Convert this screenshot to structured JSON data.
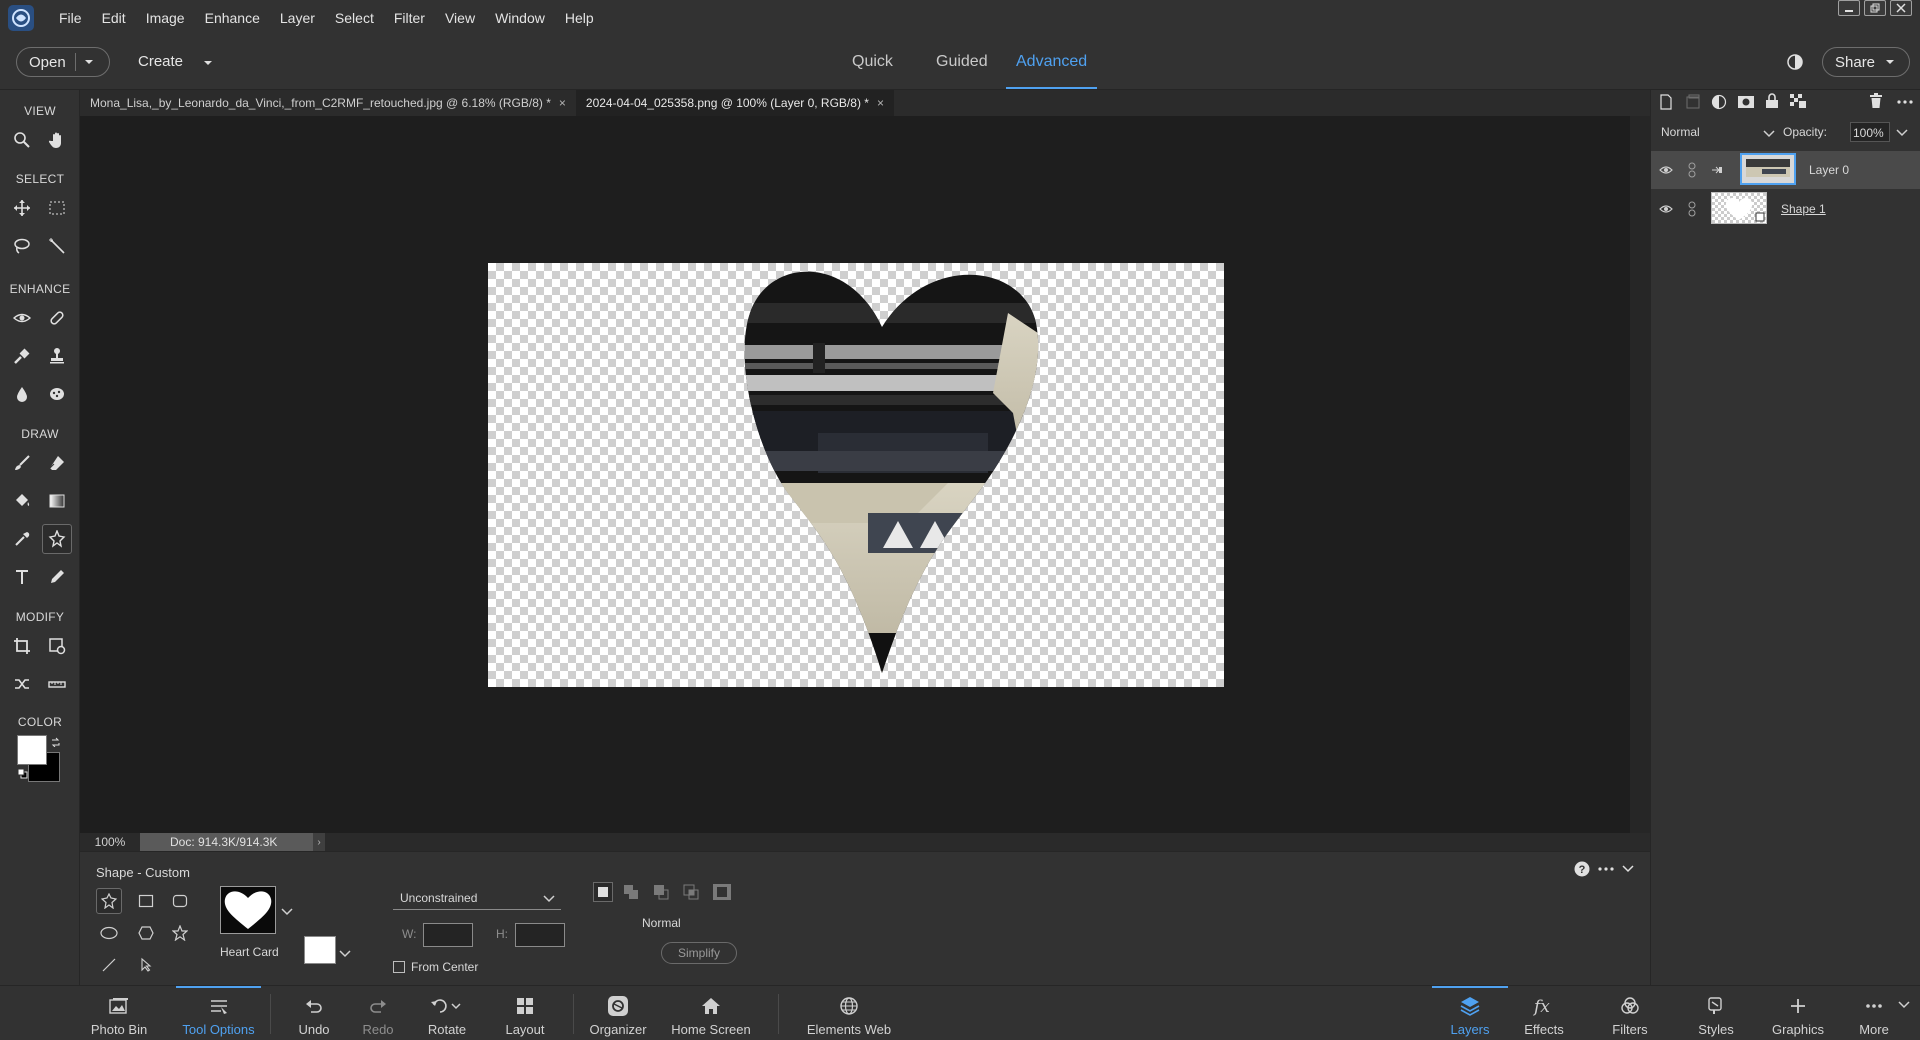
{
  "menubar": {
    "items": [
      "File",
      "Edit",
      "Image",
      "Enhance",
      "Layer",
      "Select",
      "Filter",
      "View",
      "Window",
      "Help"
    ]
  },
  "topbar": {
    "open_label": "Open",
    "create_label": "Create",
    "modes": [
      "Quick",
      "Guided",
      "Advanced"
    ],
    "active_mode": "Advanced",
    "share_label": "Share"
  },
  "toolbar": {
    "sections": {
      "view": "VIEW",
      "select": "SELECT",
      "enhance": "ENHANCE",
      "draw": "DRAW",
      "modify": "MODIFY",
      "color": "COLOR"
    }
  },
  "tabs": [
    {
      "title": "Mona_Lisa,_by_Leonardo_da_Vinci,_from_C2RMF_retouched.jpg @ 6.18% (RGB/8) *",
      "close": "×",
      "active": false
    },
    {
      "title": "2024-04-04_025358.png @ 100% (Layer 0, RGB/8) *",
      "close": "×",
      "active": true
    }
  ],
  "status": {
    "zoom": "100%",
    "doc": "Doc: 914.3K/914.3K",
    "arrow": "›"
  },
  "options": {
    "title": "Shape - Custom",
    "shape_name": "Heart Card",
    "constraint": "Unconstrained",
    "w_label": "W:",
    "h_label": "H:",
    "from_center": "From Center",
    "blend_mode": "Normal",
    "simplify": "Simplify"
  },
  "layers_panel": {
    "blend_mode": "Normal",
    "opacity_label": "Opacity:",
    "opacity_value": "100%",
    "layers": [
      {
        "name": "Layer 0",
        "selected": true
      },
      {
        "name": "Shape 1",
        "selected": false
      }
    ]
  },
  "bottombar": {
    "left": [
      "Photo Bin",
      "Tool Options",
      "Undo",
      "Redo",
      "Rotate",
      "Layout",
      "Organizer",
      "Home Screen",
      "Elements Web"
    ],
    "right": [
      "Layers",
      "Effects",
      "Filters",
      "Styles",
      "Graphics",
      "More"
    ],
    "active_left": "Tool Options",
    "active_right": "Layers"
  },
  "colors": {
    "accent": "#4fa1f0",
    "panel": "#323232",
    "canvas": "#1e1e1e"
  }
}
